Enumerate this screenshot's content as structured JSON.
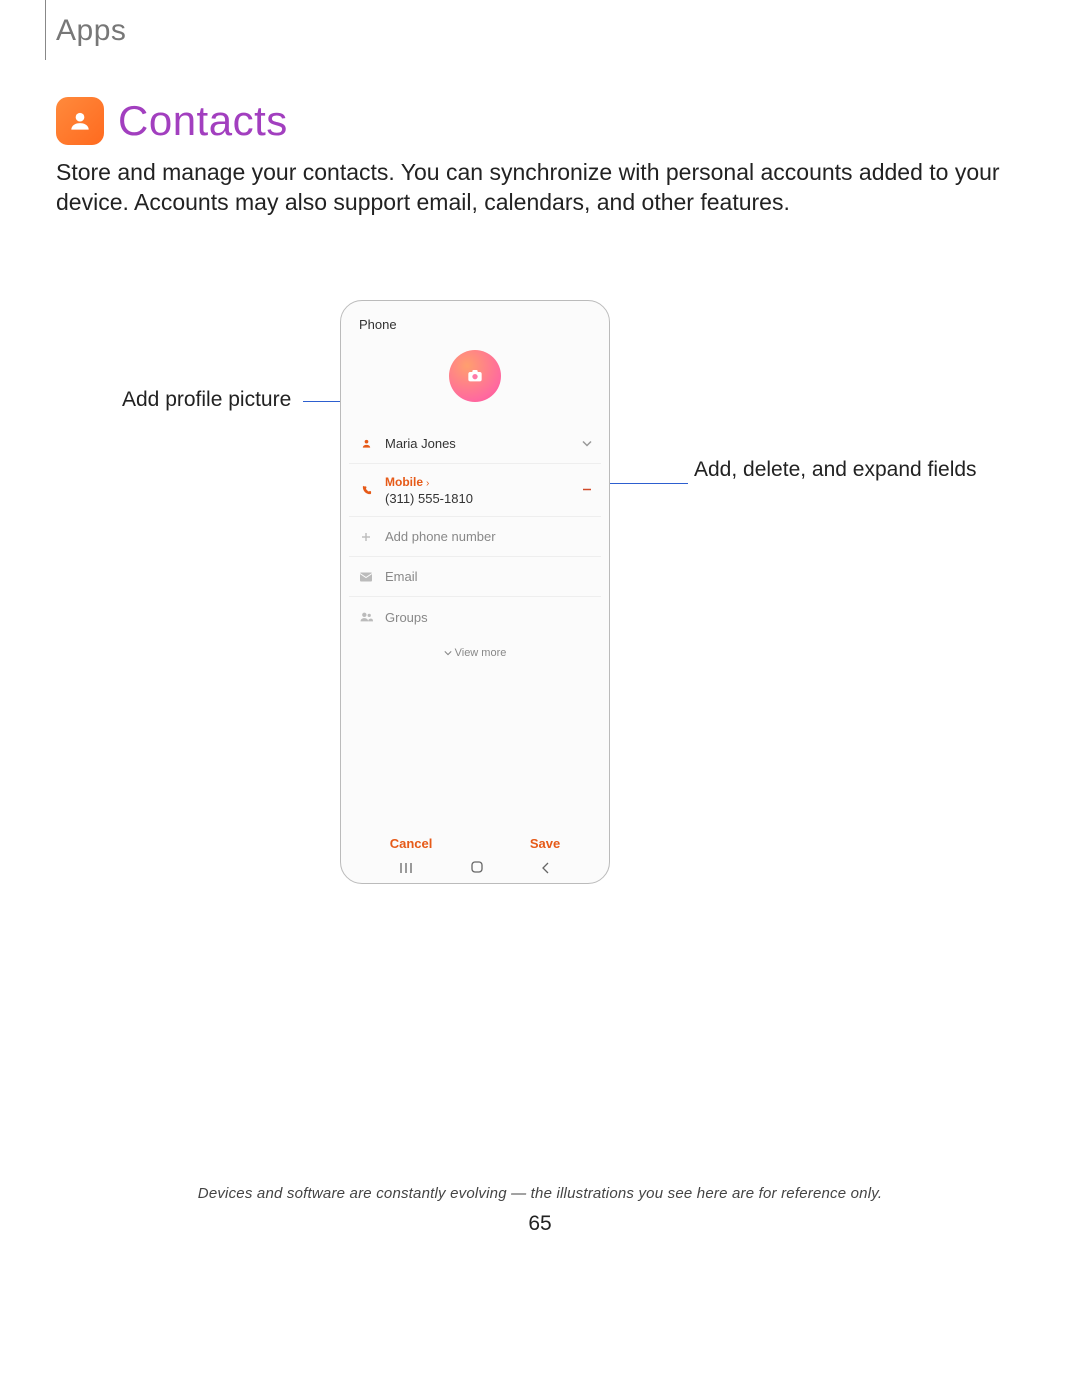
{
  "section_label": "Apps",
  "title": "Contacts",
  "description": "Store and manage your contacts. You can synchronize with personal accounts added to your device. Accounts may also support email, calendars, and other features.",
  "callouts": {
    "left": "Add profile picture",
    "right": "Add, delete, and expand fields"
  },
  "phone": {
    "header": "Phone",
    "name_value": "Maria Jones",
    "mobile_label": "Mobile",
    "mobile_value": "(311) 555-1810",
    "add_phone": "Add phone number",
    "email": "Email",
    "groups": "Groups",
    "view_more": "View more",
    "cancel": "Cancel",
    "save": "Save"
  },
  "footnote": "Devices and software are constantly evolving — the illustrations you see here are for reference only.",
  "page_number": "65"
}
